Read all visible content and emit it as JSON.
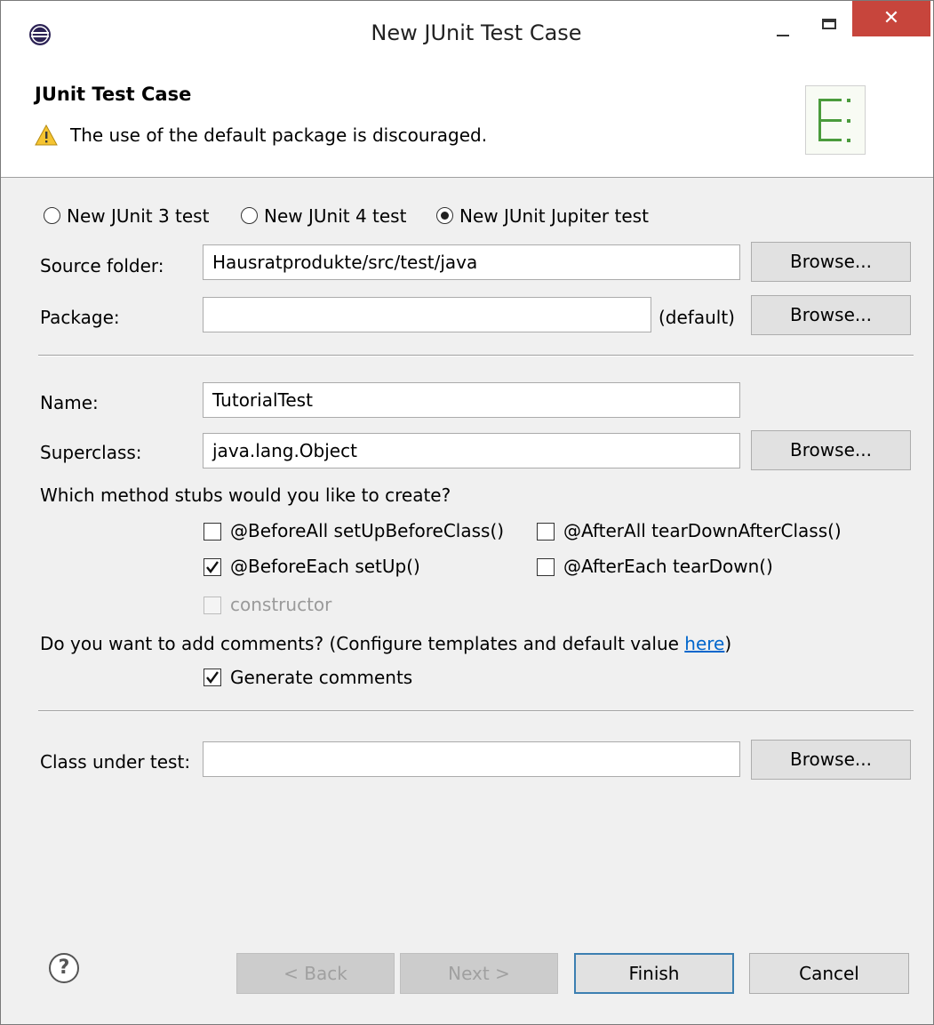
{
  "window": {
    "title": "New JUnit Test Case",
    "close_glyph": "✕"
  },
  "header": {
    "title": "JUnit Test Case",
    "message": "The use of the default package is discouraged."
  },
  "test_version": {
    "options": [
      "New JUnit 3 test",
      "New JUnit 4 test",
      "New JUnit Jupiter test"
    ],
    "selected": "New JUnit Jupiter test"
  },
  "source_folder": {
    "label": "Source folder:",
    "value": "Hausratprodukte/src/test/java",
    "browse_label": "Browse..."
  },
  "package": {
    "label": "Package:",
    "value": "",
    "hint": "(default)",
    "browse_label": "Browse..."
  },
  "name": {
    "label": "Name:",
    "value": "TutorialTest"
  },
  "superclass": {
    "label": "Superclass:",
    "value": "java.lang.Object",
    "browse_label": "Browse..."
  },
  "method_stubs": {
    "question": "Which method stubs would you like to create?",
    "before_all": {
      "label": "@BeforeAll setUpBeforeClass()",
      "checked": false
    },
    "after_all": {
      "label": "@AfterAll tearDownAfterClass()",
      "checked": false
    },
    "before_each": {
      "label": "@BeforeEach setUp()",
      "checked": true
    },
    "after_each": {
      "label": "@AfterEach tearDown()",
      "checked": false
    },
    "constructor": {
      "label": "constructor",
      "checked": false,
      "enabled": false
    }
  },
  "comments": {
    "question_prefix": "Do you want to add comments? (Configure templates and default value ",
    "link_text": "here",
    "question_suffix": ")",
    "generate": {
      "label": "Generate comments",
      "checked": true
    }
  },
  "class_under_test": {
    "label": "Class under test:",
    "value": "",
    "browse_label": "Browse..."
  },
  "footer": {
    "help_glyph": "?",
    "back_label": "< Back",
    "next_label": "Next >",
    "finish_label": "Finish",
    "cancel_label": "Cancel"
  },
  "colors": {
    "close_button": "#c7453c",
    "link": "#0066cc",
    "default_button_border": "#3c7fb1"
  }
}
